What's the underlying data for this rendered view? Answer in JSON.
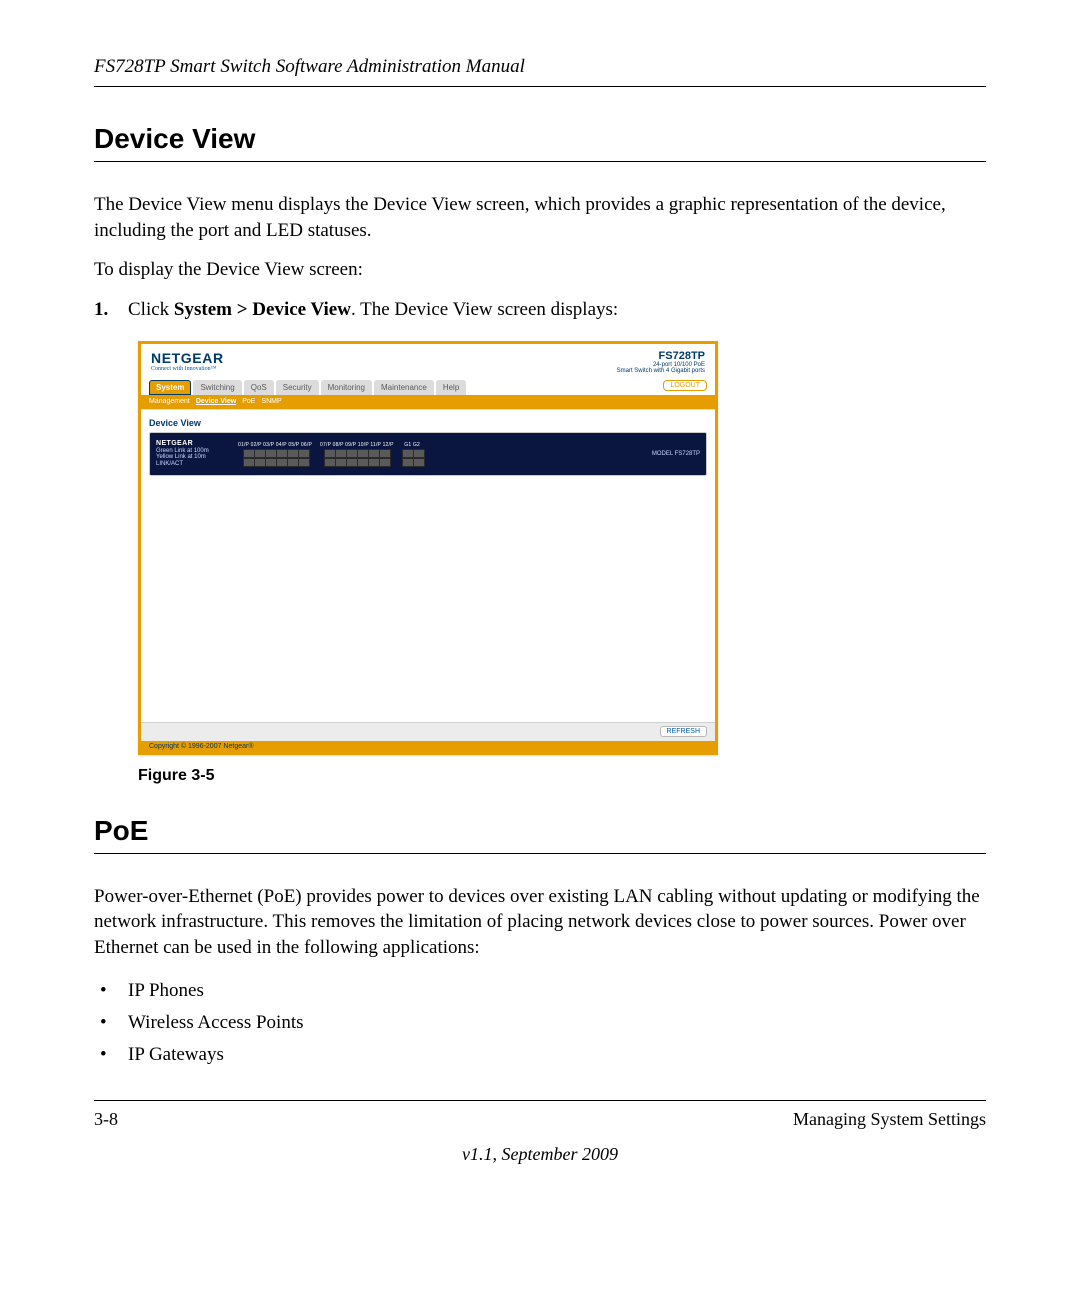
{
  "header": {
    "title": "FS728TP Smart Switch Software Administration Manual"
  },
  "section1": {
    "heading": "Device View",
    "para1": "The Device View menu displays the Device View screen, which provides a graphic representation of the device, including the port and LED statuses.",
    "para2": "To display the Device View screen:",
    "step1_prefix": "Click ",
    "step1_bold": "System > Device View",
    "step1_suffix": ". The Device View screen displays:"
  },
  "figure": {
    "caption": "Figure 3-5",
    "app": {
      "brand": "NETGEAR",
      "brand_tag": "Connect with Innovation™",
      "model": "FS728TP",
      "model_line1": "24-port 10/100 PoE",
      "model_line2": "Smart Switch with 4 Gigabit ports",
      "logout": "LOGOUT",
      "tabs": [
        "System",
        "Switching",
        "QoS",
        "Security",
        "Monitoring",
        "Maintenance",
        "Help"
      ],
      "subtabs": [
        "Management",
        "Device View",
        "PoE",
        "SNMP"
      ],
      "subtabs_active_index": 1,
      "panel_title": "Device View",
      "device_brand": "NETGEAR",
      "device_model": "MODEL FS728TP",
      "refresh": "REFRESH",
      "copyright": "Copyright © 1996-2007 Netgear®"
    }
  },
  "section2": {
    "heading": "PoE",
    "para": "Power-over-Ethernet (PoE) provides power to devices over existing LAN cabling without updating or modifying the network infrastructure. This removes the limitation of placing network devices close to power sources. Power over Ethernet can be used in the following applications:",
    "bullets": [
      "IP Phones",
      "Wireless Access Points",
      "IP Gateways"
    ]
  },
  "footer": {
    "page": "3-8",
    "chapter": "Managing System Settings",
    "version": "v1.1, September 2009"
  }
}
